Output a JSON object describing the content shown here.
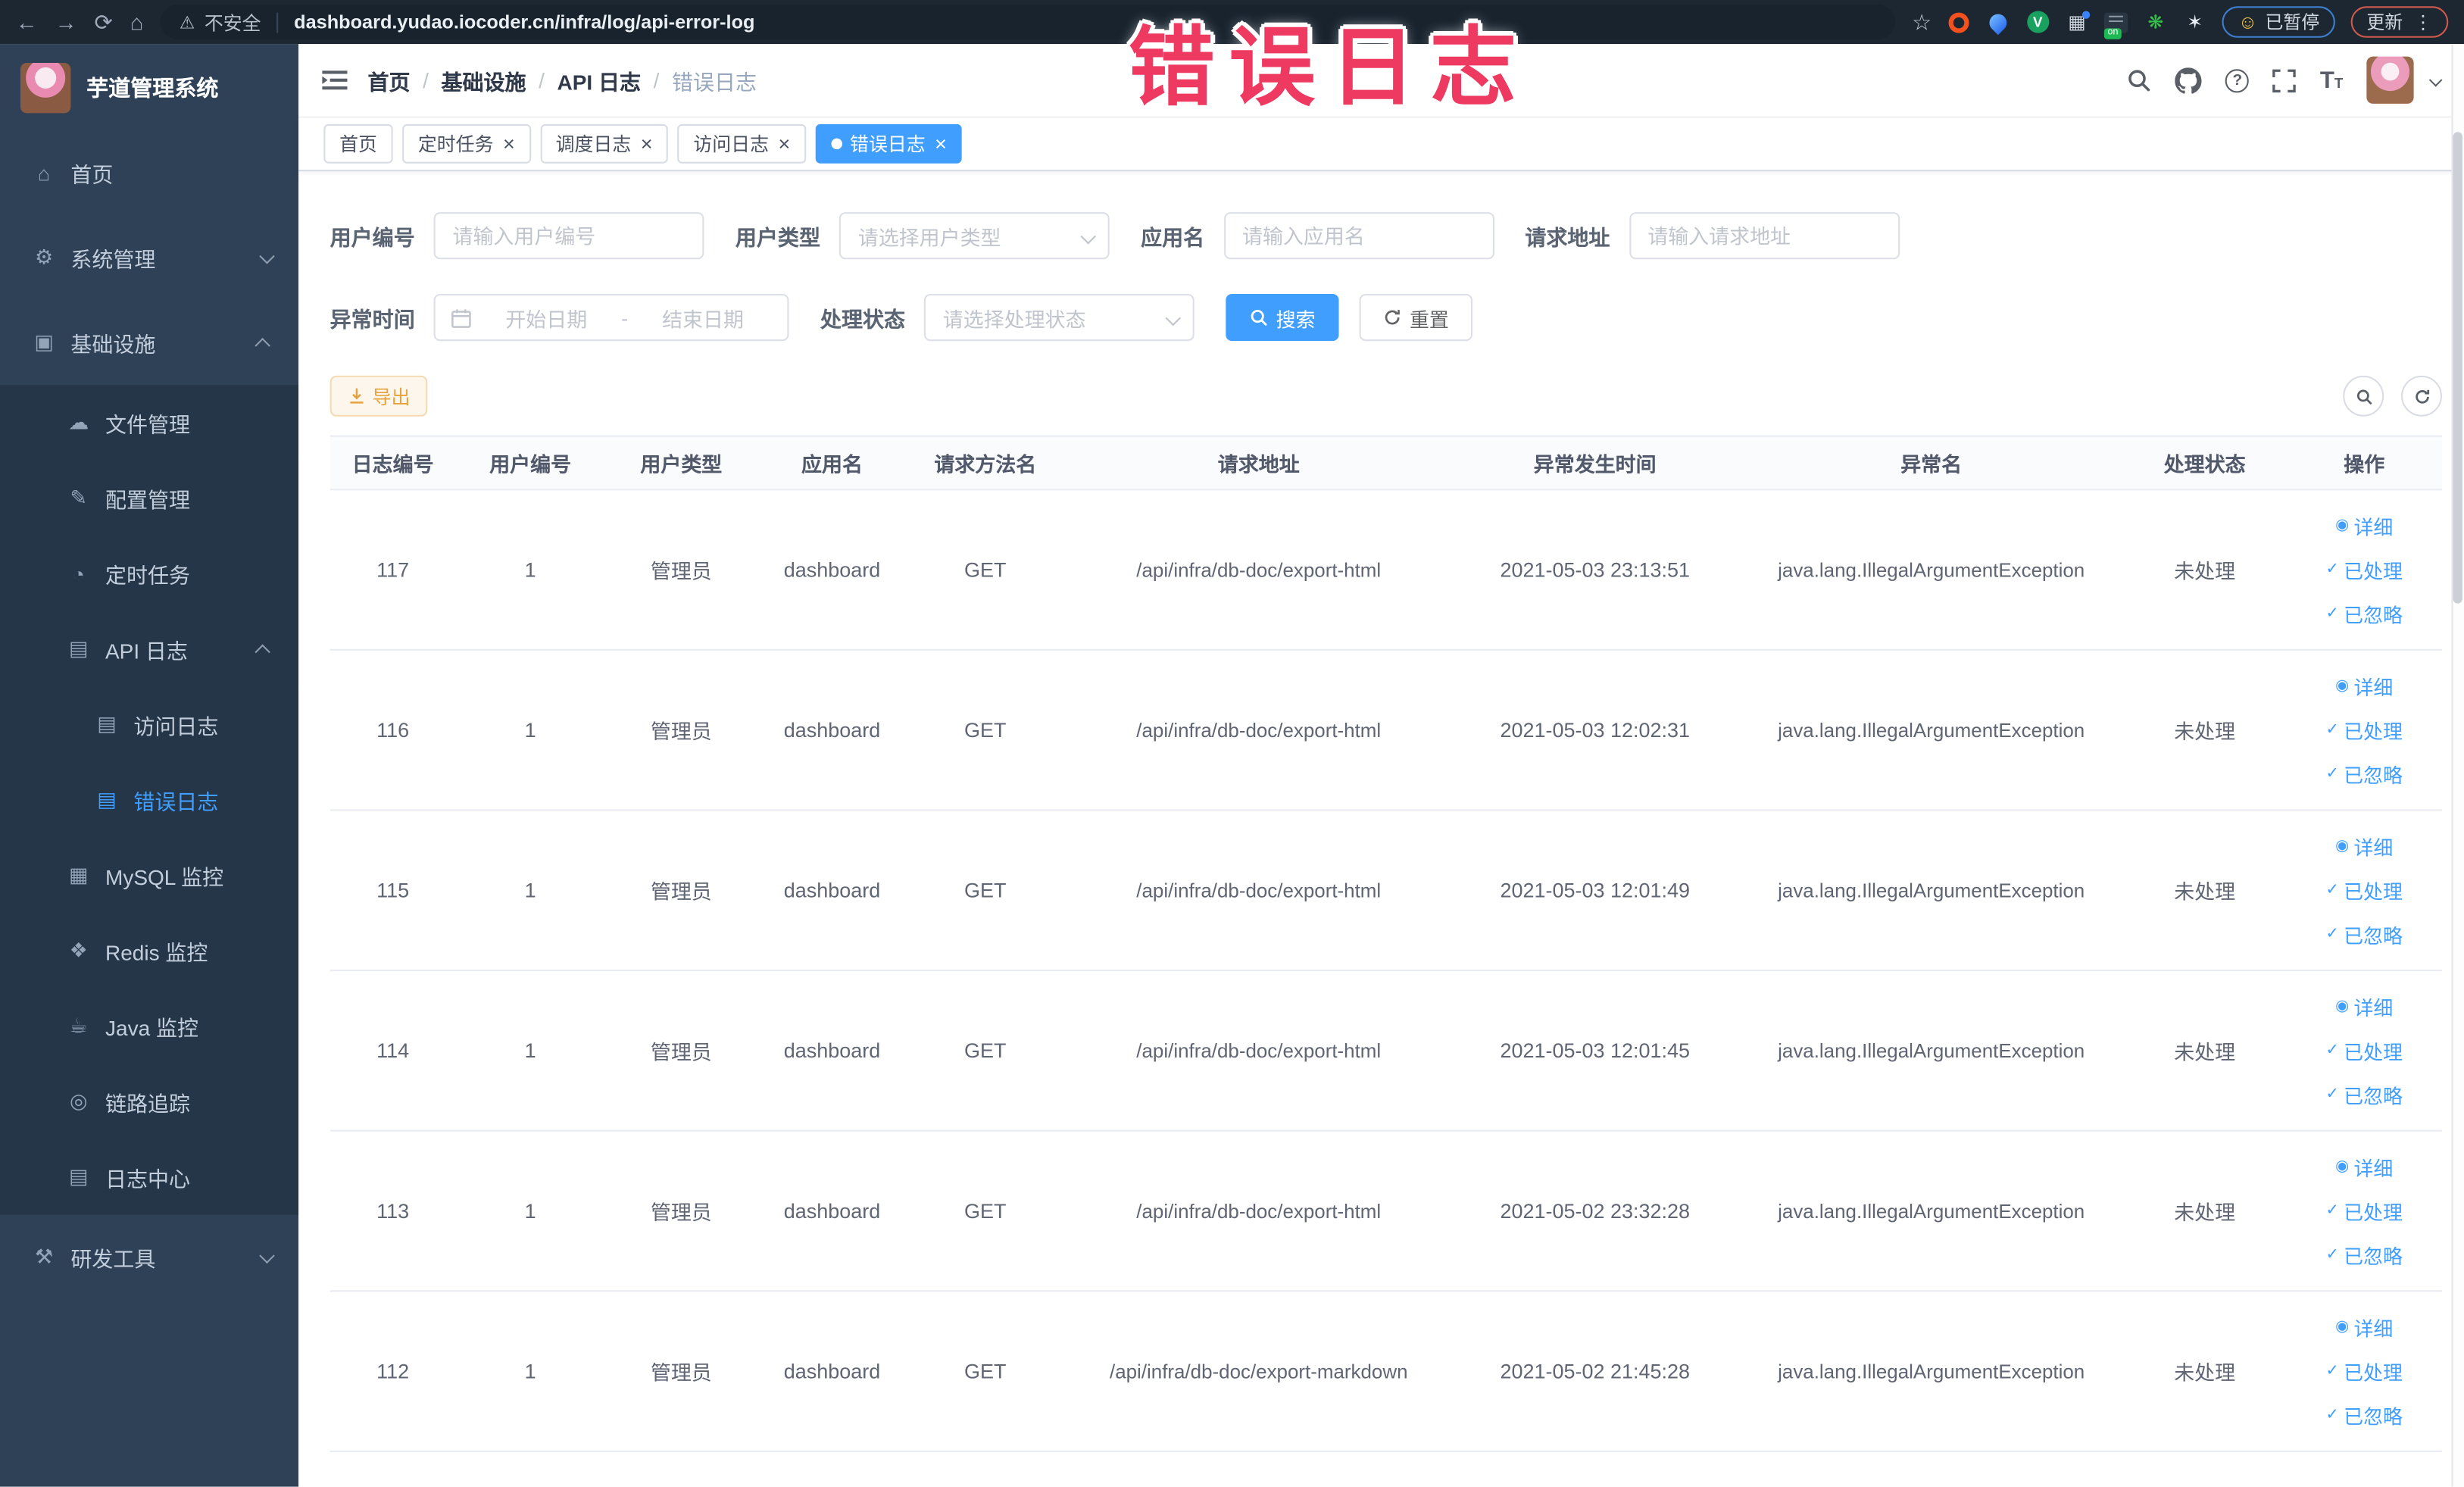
{
  "watermark": "错误日志",
  "browser": {
    "security_label": "不安全",
    "url": "dashboard.yudao.iocoder.cn/infra/log/api-error-log",
    "paused_label": "已暂停",
    "update_label": "更新"
  },
  "glyphs": {
    "home-icon": "⌂",
    "gear-icon": "⚙",
    "monitor-icon": "▣",
    "upload-icon": "☁",
    "edit-icon": "✎",
    "timer-icon": "◔",
    "log-icon": "▤",
    "mysql-icon": "▦",
    "redis-icon": "❖",
    "java-icon": "☕",
    "trace-icon": "◎",
    "tools-icon": "⚒",
    "eye-icon": "◉",
    "check-icon": "✓"
  },
  "sidebar": {
    "logo_title": "芋道管理系统",
    "items": [
      {
        "id": "home",
        "label": "首页",
        "icon": "home-icon",
        "level": 1
      },
      {
        "id": "system",
        "label": "系统管理",
        "icon": "gear-icon",
        "level": 1,
        "chevron": "down"
      },
      {
        "id": "infra",
        "label": "基础设施",
        "icon": "monitor-icon",
        "level": 1,
        "chevron": "up"
      },
      {
        "id": "file",
        "label": "文件管理",
        "icon": "upload-icon",
        "level": 2,
        "sub": true
      },
      {
        "id": "config",
        "label": "配置管理",
        "icon": "edit-icon",
        "level": 2,
        "sub": true
      },
      {
        "id": "job",
        "label": "定时任务",
        "icon": "timer-icon",
        "level": 2,
        "sub": true
      },
      {
        "id": "api-log",
        "label": "API 日志",
        "icon": "log-icon",
        "level": 2,
        "sub": true,
        "chevron": "up"
      },
      {
        "id": "access-log",
        "label": "访问日志",
        "icon": "log-icon",
        "level": 3,
        "sub": true
      },
      {
        "id": "error-log",
        "label": "错误日志",
        "icon": "log-icon",
        "level": 3,
        "sub": true,
        "active": true
      },
      {
        "id": "mysql",
        "label": "MySQL 监控",
        "icon": "mysql-icon",
        "level": 2,
        "sub": true
      },
      {
        "id": "redis",
        "label": "Redis 监控",
        "icon": "redis-icon",
        "level": 2,
        "sub": true
      },
      {
        "id": "java",
        "label": "Java 监控",
        "icon": "java-icon",
        "level": 2,
        "sub": true
      },
      {
        "id": "trace",
        "label": "链路追踪",
        "icon": "trace-icon",
        "level": 2,
        "sub": true
      },
      {
        "id": "log-center",
        "label": "日志中心",
        "icon": "log-icon",
        "level": 2,
        "sub": true
      },
      {
        "id": "dev-tools",
        "label": "研发工具",
        "icon": "tools-icon",
        "level": 1,
        "chevron": "down"
      }
    ]
  },
  "header": {
    "breadcrumb": [
      "首页",
      "基础设施",
      "API 日志",
      "错误日志"
    ]
  },
  "tabs": [
    {
      "label": "首页",
      "closable": false,
      "active": false
    },
    {
      "label": "定时任务",
      "closable": true,
      "active": false
    },
    {
      "label": "调度日志",
      "closable": true,
      "active": false
    },
    {
      "label": "访问日志",
      "closable": true,
      "active": false
    },
    {
      "label": "错误日志",
      "closable": true,
      "active": true
    }
  ],
  "filters": {
    "user_id": {
      "label": "用户编号",
      "placeholder": "请输入用户编号"
    },
    "user_type": {
      "label": "用户类型",
      "placeholder": "请选择用户类型"
    },
    "app_name": {
      "label": "应用名",
      "placeholder": "请输入应用名"
    },
    "request_url": {
      "label": "请求地址",
      "placeholder": "请输入请求地址"
    },
    "exception_time": {
      "label": "异常时间",
      "start_placeholder": "开始日期",
      "separator": "-",
      "end_placeholder": "结束日期"
    },
    "process_status": {
      "label": "处理状态",
      "placeholder": "请选择处理状态"
    },
    "search_label": "搜索",
    "reset_label": "重置"
  },
  "toolbar": {
    "export_label": "导出"
  },
  "table": {
    "columns": [
      {
        "key": "id",
        "label": "日志编号"
      },
      {
        "key": "user_id",
        "label": "用户编号"
      },
      {
        "key": "user_type",
        "label": "用户类型"
      },
      {
        "key": "app",
        "label": "应用名"
      },
      {
        "key": "method",
        "label": "请求方法名"
      },
      {
        "key": "url",
        "label": "请求地址"
      },
      {
        "key": "time",
        "label": "异常发生时间"
      },
      {
        "key": "exception",
        "label": "异常名"
      },
      {
        "key": "status",
        "label": "处理状态"
      },
      {
        "key": "actions",
        "label": "操作"
      }
    ],
    "actions": [
      {
        "id": "detail",
        "label": "详细",
        "icon": "eye-icon"
      },
      {
        "id": "processed",
        "label": "已处理",
        "icon": "check-icon"
      },
      {
        "id": "ignored",
        "label": "已忽略",
        "icon": "check-icon"
      }
    ],
    "rows": [
      {
        "id": "117",
        "user_id": "1",
        "user_type": "管理员",
        "app": "dashboard",
        "method": "GET",
        "url": "/api/infra/db-doc/export-html",
        "time": "2021-05-03 23:13:51",
        "exception": "java.lang.IllegalArgumentException",
        "status": "未处理"
      },
      {
        "id": "116",
        "user_id": "1",
        "user_type": "管理员",
        "app": "dashboard",
        "method": "GET",
        "url": "/api/infra/db-doc/export-html",
        "time": "2021-05-03 12:02:31",
        "exception": "java.lang.IllegalArgumentException",
        "status": "未处理"
      },
      {
        "id": "115",
        "user_id": "1",
        "user_type": "管理员",
        "app": "dashboard",
        "method": "GET",
        "url": "/api/infra/db-doc/export-html",
        "time": "2021-05-03 12:01:49",
        "exception": "java.lang.IllegalArgumentException",
        "status": "未处理"
      },
      {
        "id": "114",
        "user_id": "1",
        "user_type": "管理员",
        "app": "dashboard",
        "method": "GET",
        "url": "/api/infra/db-doc/export-html",
        "time": "2021-05-03 12:01:45",
        "exception": "java.lang.IllegalArgumentException",
        "status": "未处理"
      },
      {
        "id": "113",
        "user_id": "1",
        "user_type": "管理员",
        "app": "dashboard",
        "method": "GET",
        "url": "/api/infra/db-doc/export-html",
        "time": "2021-05-02 23:32:28",
        "exception": "java.lang.IllegalArgumentException",
        "status": "未处理"
      },
      {
        "id": "112",
        "user_id": "1",
        "user_type": "管理员",
        "app": "dashboard",
        "method": "GET",
        "url": "/api/infra/db-doc/export-markdown",
        "time": "2021-05-02 21:45:28",
        "exception": "java.lang.IllegalArgumentException",
        "status": "未处理"
      }
    ]
  }
}
